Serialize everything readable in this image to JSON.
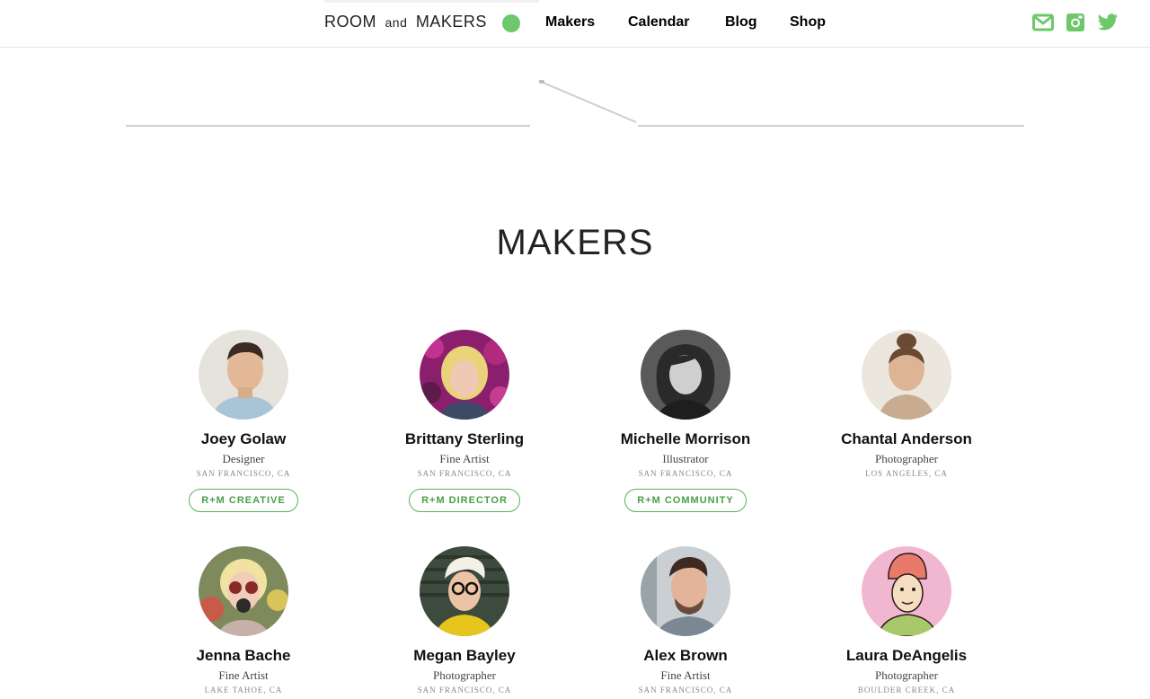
{
  "header": {
    "brand": {
      "part1": "ROOM",
      "part2": "and",
      "part3": "MAKERS"
    },
    "nav": [
      "Makers",
      "Calendar",
      "Blog",
      "Shop"
    ],
    "accent": "#6cc86a",
    "social": [
      "mail-icon",
      "instagram-icon",
      "twitter-icon"
    ]
  },
  "main": {
    "title": "MAKERS",
    "makers": [
      {
        "name": "Joey Golaw",
        "role": "Designer",
        "location": "SAN FRANCISCO, CA",
        "tag": "R+M CREATIVE"
      },
      {
        "name": "Brittany Sterling",
        "role": "Fine Artist",
        "location": "SAN FRANCISCO, CA",
        "tag": "R+M DIRECTOR"
      },
      {
        "name": "Michelle Morrison",
        "role": "Illustrator",
        "location": "SAN FRANCISCO, CA",
        "tag": "R+M COMMUNITY"
      },
      {
        "name": "Chantal Anderson",
        "role": "Photographer",
        "location": "LOS ANGELES, CA",
        "tag": ""
      },
      {
        "name": "Jenna Bache",
        "role": "Fine Artist",
        "location": "LAKE TAHOE, CA",
        "tag": ""
      },
      {
        "name": "Megan Bayley",
        "role": "Photographer",
        "location": "SAN FRANCISCO, CA",
        "tag": ""
      },
      {
        "name": "Alex Brown",
        "role": "Fine Artist",
        "location": "SAN FRANCISCO, CA",
        "tag": ""
      },
      {
        "name": "Laura DeAngelis",
        "role": "Photographer",
        "location": "BOULDER CREEK, CA",
        "tag": ""
      }
    ]
  }
}
